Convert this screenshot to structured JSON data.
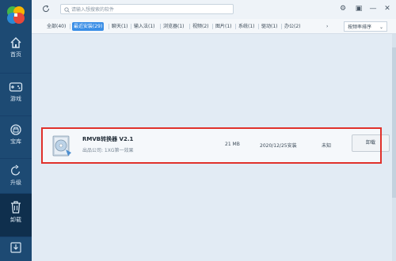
{
  "sidebar": {
    "items": [
      {
        "label": "首页",
        "icon": "home-icon"
      },
      {
        "label": "游戏",
        "icon": "gamepad-icon"
      },
      {
        "label": "宝库",
        "icon": "treasure-icon"
      },
      {
        "label": "升级",
        "icon": "upgrade-icon"
      },
      {
        "label": "卸载",
        "icon": "trash-icon"
      },
      {
        "label": "",
        "icon": "download-icon"
      }
    ]
  },
  "search": {
    "placeholder": "请输入想搜索的软件"
  },
  "window_controls": [
    {
      "icon": "settings-icon",
      "label": "⚙"
    },
    {
      "icon": "box-icon",
      "label": "▣"
    },
    {
      "icon": "minimize-icon",
      "label": "—"
    },
    {
      "icon": "close-icon",
      "label": "✕"
    }
  ],
  "tabs": [
    {
      "label": "全部(40)"
    },
    {
      "label": "最近安装(29)",
      "active": true
    },
    {
      "label": "聊天(1)"
    },
    {
      "label": "输入法(1)"
    },
    {
      "label": "浏览器(1)"
    },
    {
      "label": "视频(2)"
    },
    {
      "label": "图片(1)"
    },
    {
      "label": "系统(1)"
    },
    {
      "label": "驱动(1)"
    },
    {
      "label": "办公(2)"
    }
  ],
  "tab_more": "›",
  "sort": {
    "label": "按频率排序",
    "chevron": "⌄"
  },
  "app": {
    "name": "RMVB转换器 V2.1",
    "publisher": "出品公司: 1XG第一效果",
    "size": "21 MB",
    "installed": "2020/12/25安装",
    "frequency": "未知",
    "uninstall_label": "卸载"
  },
  "colors": {
    "sidebar_bg": "#1d4a73",
    "active_tab": "#3a8ee6",
    "highlight": "#e0312b"
  }
}
